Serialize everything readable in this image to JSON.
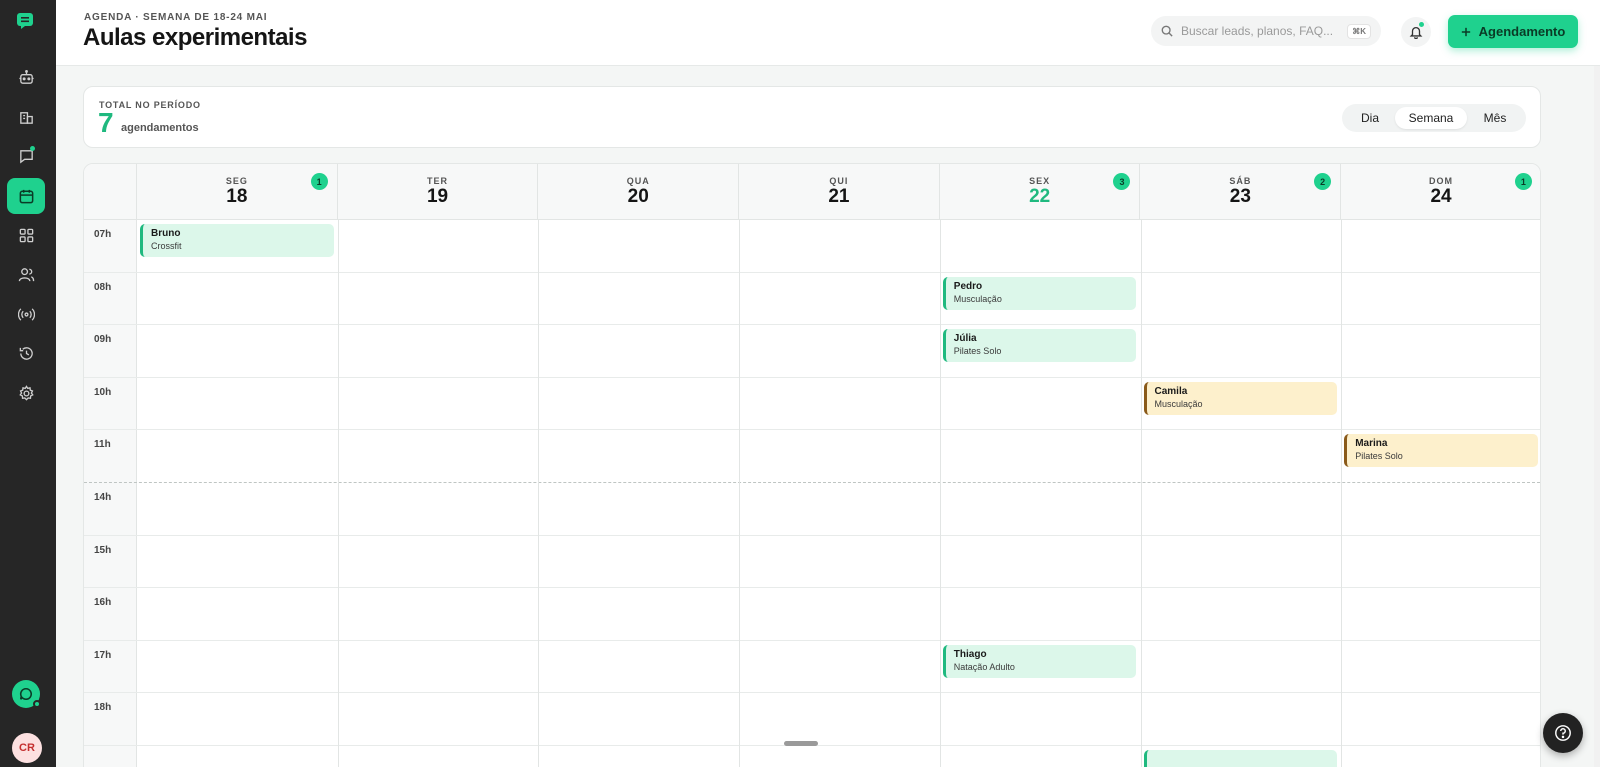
{
  "sidebar": {
    "avatar_initials": "CR",
    "items": [
      {
        "name": "bot-icon",
        "active": false
      },
      {
        "name": "building-icon",
        "active": false
      },
      {
        "name": "chat-icon",
        "active": false
      },
      {
        "name": "calendar-icon",
        "active": true
      },
      {
        "name": "dashboard-icon",
        "active": false
      },
      {
        "name": "users-icon",
        "active": false
      },
      {
        "name": "broadcast-icon",
        "active": false
      },
      {
        "name": "history-icon",
        "active": false
      },
      {
        "name": "gear-icon",
        "active": false
      }
    ]
  },
  "header": {
    "eyebrow": "AGENDA · SEMANA DE 18-24 MAI",
    "title": "Aulas experimentais",
    "search_placeholder": "Buscar leads, planos, FAQ...",
    "search_shortcut": "⌘K",
    "add_button_label": "Agendamento"
  },
  "summary": {
    "label": "TOTAL NO PERÍODO",
    "count": "7",
    "unit": "agendamentos",
    "views": [
      "Dia",
      "Semana",
      "Mês"
    ],
    "active_view": "Semana"
  },
  "calendar": {
    "days": [
      {
        "abbr": "SEG",
        "num": "18",
        "badge": "1",
        "today": false
      },
      {
        "abbr": "TER",
        "num": "19",
        "badge": "",
        "today": false
      },
      {
        "abbr": "QUA",
        "num": "20",
        "badge": "",
        "today": false
      },
      {
        "abbr": "QUI",
        "num": "21",
        "badge": "",
        "today": false
      },
      {
        "abbr": "SEX",
        "num": "22",
        "badge": "3",
        "today": true
      },
      {
        "abbr": "SÁB",
        "num": "23",
        "badge": "2",
        "today": false
      },
      {
        "abbr": "DOM",
        "num": "24",
        "badge": "1",
        "today": false
      }
    ],
    "hours": [
      "07h",
      "08h",
      "09h",
      "10h",
      "11h",
      "14h",
      "15h",
      "16h",
      "17h",
      "18h",
      ""
    ],
    "events": [
      {
        "day": 0,
        "hour": 0,
        "name": "Bruno",
        "class": "Crossfit",
        "color": "green"
      },
      {
        "day": 4,
        "hour": 1,
        "name": "Pedro",
        "class": "Musculação",
        "color": "green"
      },
      {
        "day": 4,
        "hour": 2,
        "name": "Júlia",
        "class": "Pilates Solo",
        "color": "green"
      },
      {
        "day": 5,
        "hour": 3,
        "name": "Camila",
        "class": "Musculação",
        "color": "yellow"
      },
      {
        "day": 6,
        "hour": 4,
        "name": "Marina",
        "class": "Pilates Solo",
        "color": "yellow"
      },
      {
        "day": 4,
        "hour": 8,
        "name": "Thiago",
        "class": "Natação Adulto",
        "color": "green"
      },
      {
        "day": 5,
        "hour": 10,
        "name": "",
        "class": "",
        "color": "green"
      }
    ]
  },
  "colors": {
    "accent": "#1fd18e",
    "accent_text": "#1fb97f",
    "sidebar_bg": "#262626",
    "event_green_bg": "#dcf7ea",
    "event_yellow_bg": "#fdf0cc"
  }
}
